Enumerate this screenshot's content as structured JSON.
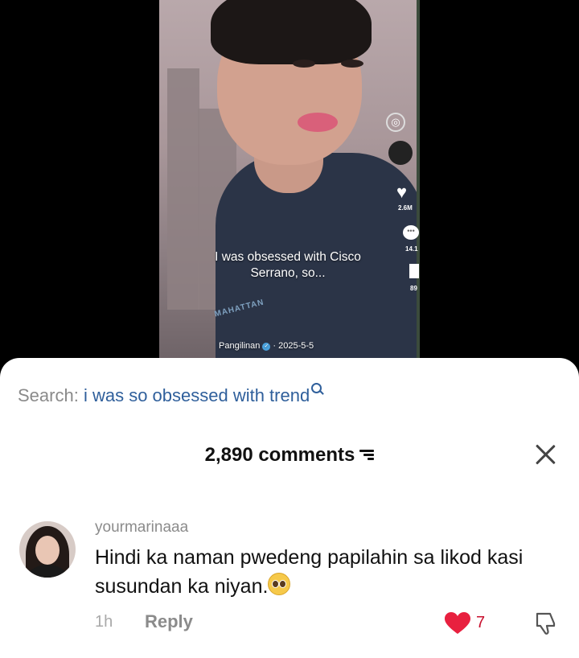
{
  "video": {
    "caption": "I was obsessed with Cisco Serrano, so...",
    "handle": "Pangilinan",
    "date": "· 2025-5-5",
    "shirt_text": "MAHATTAN",
    "likes_count": "2.6M",
    "comments_count": "14.1",
    "saves_count": "89"
  },
  "search": {
    "label": "Search:",
    "query": "i was so obsessed with trend"
  },
  "comments_header": {
    "title": "2,890 comments"
  },
  "comment": {
    "username": "yourmarinaaa",
    "text": "Hindi ka naman pwedeng papilahin sa likod kasi susundan ka niyan.",
    "time": "1h",
    "reply_label": "Reply",
    "likes": "7"
  },
  "icons": [
    "search-icon",
    "sort-icon",
    "close-icon",
    "heart-icon",
    "dislike-icon",
    "pleading-face-emoji"
  ],
  "colors": {
    "accent_red": "#c8102e",
    "link_blue": "#2f5f9b"
  }
}
